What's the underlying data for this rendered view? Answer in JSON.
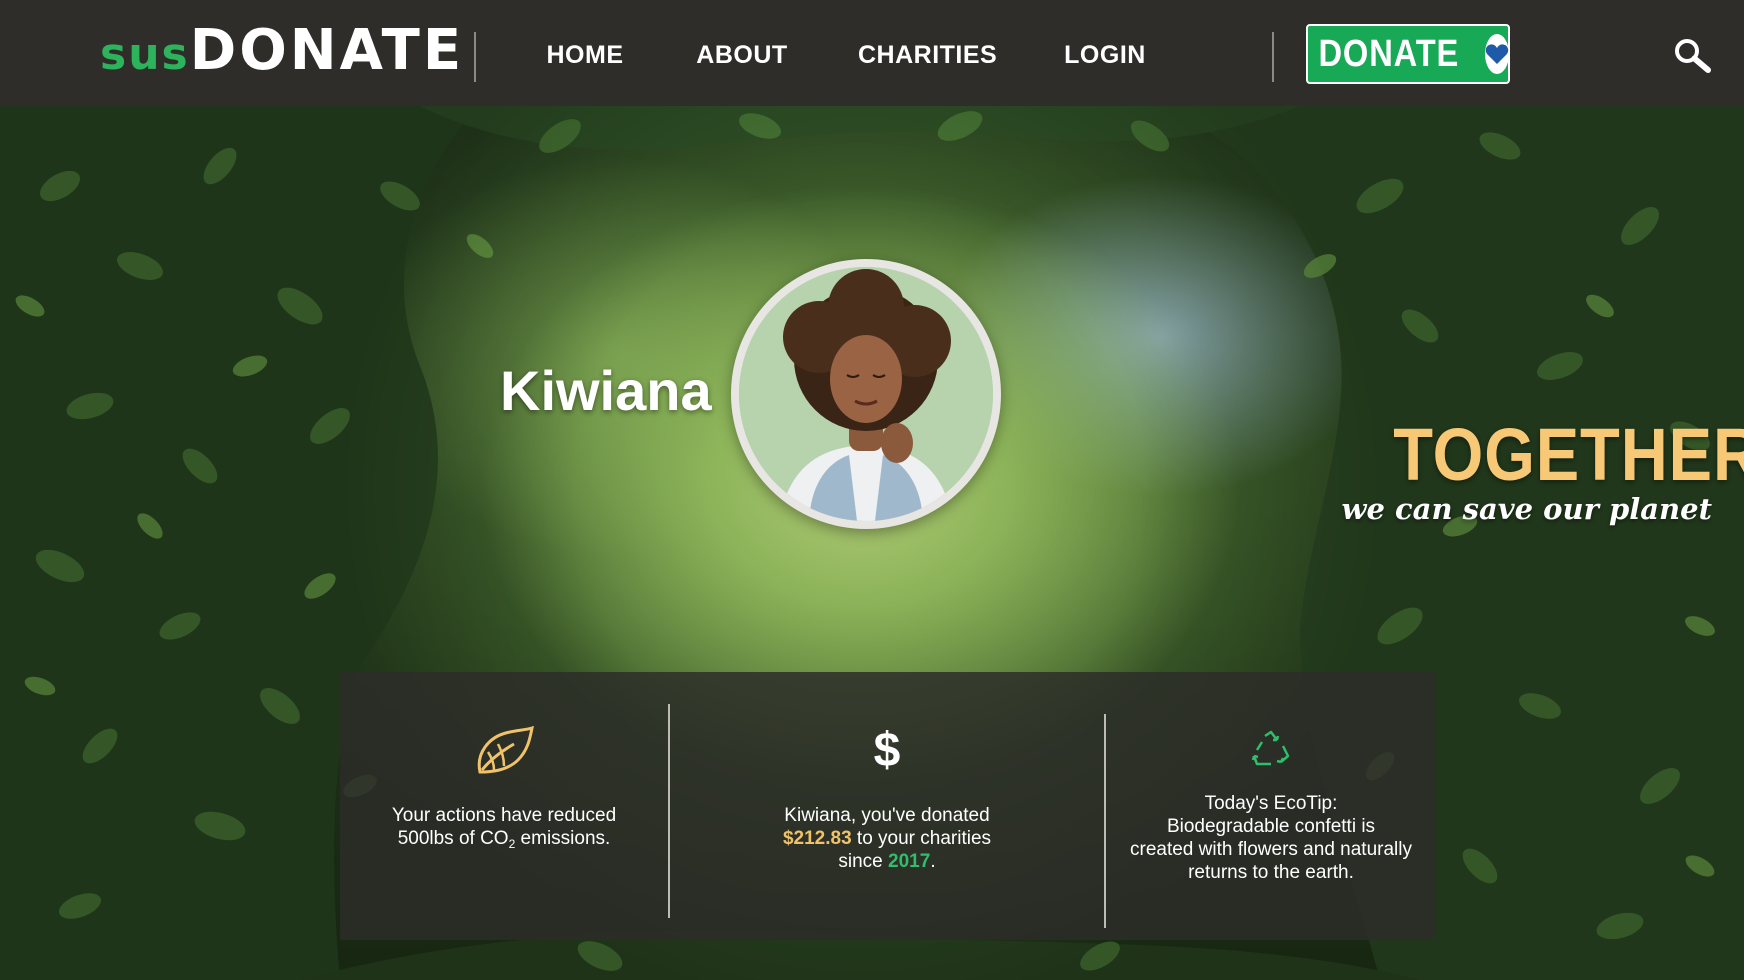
{
  "brand": {
    "logo_prefix": "sus",
    "logo_main": "DONATE"
  },
  "nav": {
    "items": [
      {
        "label": "HOME"
      },
      {
        "label": "ABOUT"
      },
      {
        "label": "CHARITIES"
      },
      {
        "label": "LOGIN"
      }
    ],
    "donate_label": "DONATE"
  },
  "icons": {
    "search": "search-icon",
    "heart": "heart-icon",
    "leaf": "leaf-icon",
    "dollar": "dollar-icon",
    "recycle": "recycle-icon"
  },
  "profile": {
    "name": "Kiwiana"
  },
  "tagline": {
    "headline": "TOGETHER",
    "subline": "we can save our planet"
  },
  "stats": {
    "co2": {
      "line1": "Your actions have reduced",
      "line2_prefix": "500lbs of CO",
      "line2_sub": "2",
      "line2_suffix": " emissions."
    },
    "donated": {
      "line1": "Kiwiana, you've donated",
      "amount": "$212.83",
      "line2_suffix": " to your charities",
      "line3_prefix": "since ",
      "year": "2017",
      "line3_suffix": "."
    },
    "ecotip": {
      "line1": "Today's EcoTip:",
      "line2": "Biodegradable confetti is",
      "line3": "created with flowers and naturally",
      "line4": "returns to the earth."
    }
  },
  "colors": {
    "header_bg": "#2e2d2a",
    "brand_green": "#2db35c",
    "donate_green": "#18a957",
    "headline_gold": "#f7c876",
    "amount_gold": "#f0c36b",
    "year_green": "#2fbf6b",
    "heart_blue": "#1e5aa8"
  }
}
